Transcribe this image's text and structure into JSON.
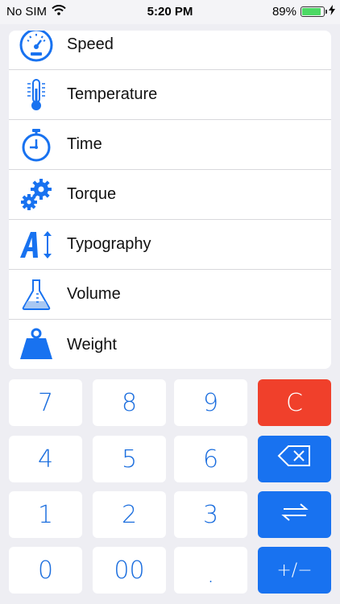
{
  "status": {
    "carrier": "No SIM",
    "time": "5:20 PM",
    "battery": "89%",
    "battery_level": 0.89
  },
  "units": [
    {
      "label": "Speed",
      "icon": "speedometer-icon"
    },
    {
      "label": "Temperature",
      "icon": "thermometer-icon"
    },
    {
      "label": "Time",
      "icon": "stopwatch-icon"
    },
    {
      "label": "Torque",
      "icon": "gears-icon"
    },
    {
      "label": "Typography",
      "icon": "typography-icon"
    },
    {
      "label": "Volume",
      "icon": "flask-icon"
    },
    {
      "label": "Weight",
      "icon": "weight-icon"
    }
  ],
  "keypad": {
    "k7": "7",
    "k8": "8",
    "k9": "9",
    "clear": "C",
    "k4": "4",
    "k5": "5",
    "k6": "6",
    "k1": "1",
    "k2": "2",
    "k3": "3",
    "k0": "0",
    "k00": "00",
    "decimal": ".",
    "sign": "+/−"
  },
  "colors": {
    "accent": "#1872f0",
    "clear": "#f0402b",
    "battery": "#4cd964"
  }
}
